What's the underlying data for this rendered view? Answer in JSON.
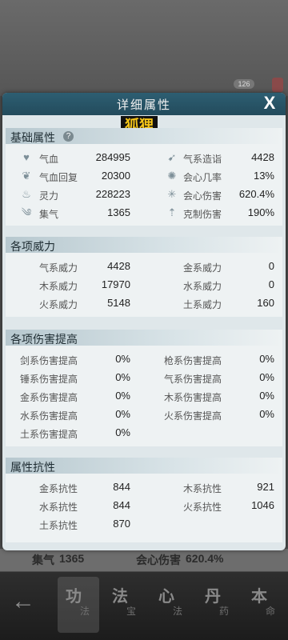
{
  "background": {
    "badge": "126",
    "row_label": "集气",
    "row_value": "1365",
    "row_label2": "会心伤害",
    "row_value2": "620.4%"
  },
  "nav": {
    "tabs": [
      {
        "big": "功",
        "small": "法"
      },
      {
        "big": "法",
        "small": "宝"
      },
      {
        "big": "心",
        "small": "法"
      },
      {
        "big": "丹",
        "small": "药"
      },
      {
        "big": "本",
        "small": "命"
      }
    ]
  },
  "modal": {
    "title": "详细属性",
    "close": "X",
    "character_name": "狐狸"
  },
  "basic": {
    "title": "基础属性",
    "help": "?",
    "left": [
      {
        "icon": "heart-icon",
        "label": "气血",
        "value": "284995"
      },
      {
        "icon": "heart-regen-icon",
        "label": "气血回复",
        "value": "20300"
      },
      {
        "icon": "flame-icon",
        "label": "灵力",
        "value": "228223"
      },
      {
        "icon": "swirl-icon",
        "label": "集气",
        "value": "1365"
      }
    ],
    "right": [
      {
        "icon": "energy-icon",
        "label": "气系造诣",
        "value": "4428"
      },
      {
        "icon": "critical-rate-icon",
        "label": "会心几率",
        "value": "13%"
      },
      {
        "icon": "critical-damage-icon",
        "label": "会心伤害",
        "value": "620.4%"
      },
      {
        "icon": "counter-damage-icon",
        "label": "克制伤害",
        "value": "190%"
      }
    ]
  },
  "power": {
    "title": "各项威力",
    "left": [
      {
        "label": "气系威力",
        "value": "4428"
      },
      {
        "label": "木系威力",
        "value": "17970"
      },
      {
        "label": "火系威力",
        "value": "5148"
      }
    ],
    "right": [
      {
        "label": "金系威力",
        "value": "0"
      },
      {
        "label": "水系威力",
        "value": "0"
      },
      {
        "label": "土系威力",
        "value": "160"
      }
    ]
  },
  "damage": {
    "title": "各项伤害提高",
    "left": [
      {
        "label": "剑系伤害提高",
        "value": "0%"
      },
      {
        "label": "锤系伤害提高",
        "value": "0%"
      },
      {
        "label": "金系伤害提高",
        "value": "0%"
      },
      {
        "label": "水系伤害提高",
        "value": "0%"
      },
      {
        "label": "土系伤害提高",
        "value": "0%"
      }
    ],
    "right": [
      {
        "label": "枪系伤害提高",
        "value": "0%"
      },
      {
        "label": "气系伤害提高",
        "value": "0%"
      },
      {
        "label": "木系伤害提高",
        "value": "0%"
      },
      {
        "label": "火系伤害提高",
        "value": "0%"
      }
    ]
  },
  "resist": {
    "title": "属性抗性",
    "left": [
      {
        "label": "金系抗性",
        "value": "844"
      },
      {
        "label": "水系抗性",
        "value": "844"
      },
      {
        "label": "土系抗性",
        "value": "870"
      }
    ],
    "right": [
      {
        "label": "木系抗性",
        "value": "921"
      },
      {
        "label": "火系抗性",
        "value": "1046"
      }
    ]
  }
}
